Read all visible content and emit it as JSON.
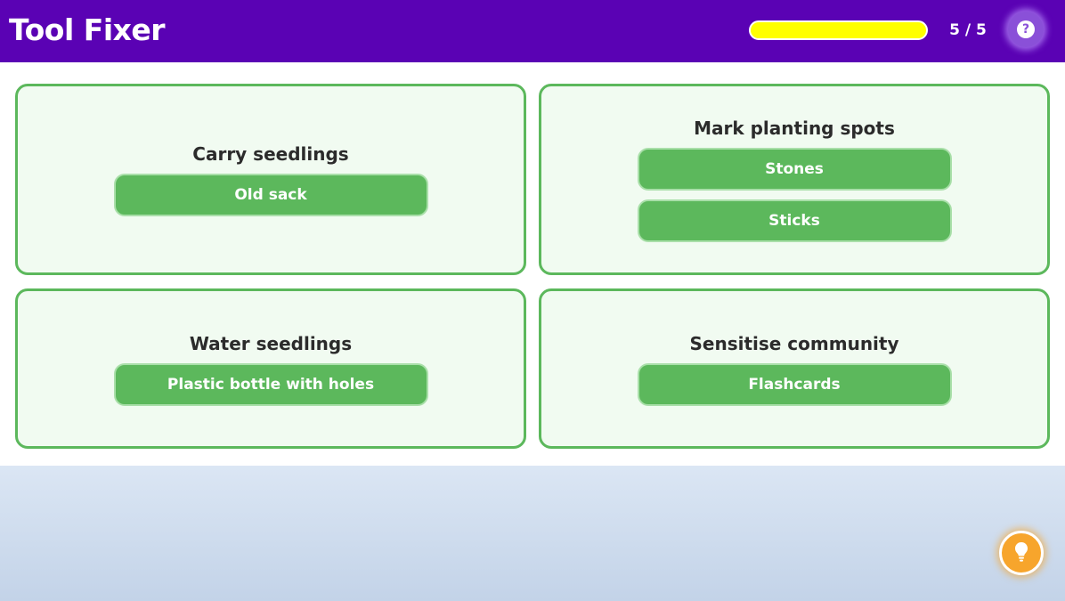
{
  "header": {
    "title": "Tool Fixer",
    "progress": {
      "value": 1.0,
      "text": "5 / 5"
    },
    "help_icon": "question-icon",
    "help_glyph": "?"
  },
  "cards": [
    {
      "title": "Carry seedlings",
      "tools": [
        "Old sack"
      ]
    },
    {
      "title": "Mark planting spots",
      "tools": [
        "Stones",
        "Sticks"
      ]
    },
    {
      "title": "Water seedlings",
      "tools": [
        "Plastic bottle with holes"
      ]
    },
    {
      "title": "Sensitise community",
      "tools": [
        "Flashcards"
      ]
    }
  ],
  "hint": {
    "icon": "lightbulb-icon"
  },
  "colors": {
    "header_bg": "#5a02b4",
    "progress_fill": "#ffff00",
    "card_border": "#5cb85c",
    "card_bg": "#f1fbf1",
    "button_bg": "#5cb85c",
    "hint_bg": "#f7a52c"
  }
}
